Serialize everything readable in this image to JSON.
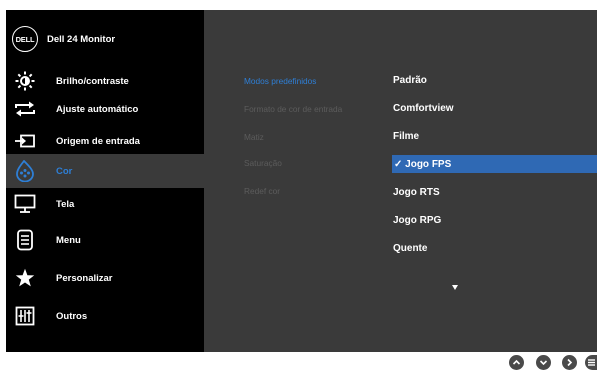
{
  "brand": {
    "logo_text": "DELL",
    "title": "Dell 24 Monitor"
  },
  "sidebar": {
    "items": [
      {
        "label": "Brilho/contraste",
        "icon": "brightness-icon"
      },
      {
        "label": "Ajuste automático",
        "icon": "auto-adjust-icon"
      },
      {
        "label": "Origem de entrada",
        "icon": "input-source-icon"
      },
      {
        "label": "Cor",
        "icon": "color-palette-icon",
        "selected": true
      },
      {
        "label": "Tela",
        "icon": "display-icon"
      },
      {
        "label": "Menu",
        "icon": "menu-icon"
      },
      {
        "label": "Personalizar",
        "icon": "star-icon"
      },
      {
        "label": "Outros",
        "icon": "others-icon"
      }
    ]
  },
  "color_menu": {
    "settings": [
      {
        "label": "Modos predefinidos",
        "active": true
      },
      {
        "label": "Formato de cor de entrada"
      },
      {
        "label": "Matiz"
      },
      {
        "label": "Saturação"
      },
      {
        "label": "Redef cor"
      }
    ],
    "preset_modes": [
      {
        "label": "Padrão"
      },
      {
        "label": "Comfortview"
      },
      {
        "label": "Filme"
      },
      {
        "label": "✓ Jogo FPS",
        "selected": true
      },
      {
        "label": "Jogo RTS"
      },
      {
        "label": "Jogo RPG"
      },
      {
        "label": "Quente"
      }
    ],
    "more_indicator": "chevron-down-icon"
  },
  "colors": {
    "accent": "#2e7fd6",
    "highlight": "#2f69b4",
    "sidebar_bg": "#000000",
    "panel_bg": "#3a3a3a"
  }
}
